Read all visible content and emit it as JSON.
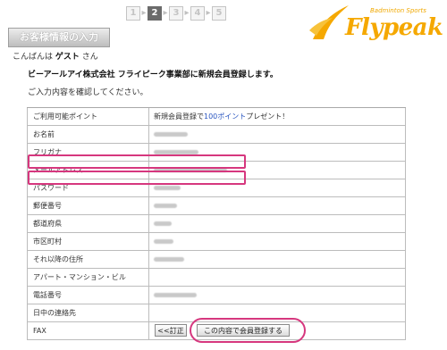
{
  "steps": [
    "1",
    "2",
    "3",
    "4",
    "5"
  ],
  "logo": {
    "subtitle": "Badminton Sports",
    "brand": "Flypeak"
  },
  "header": {
    "tab_label": "お客様情報の入力"
  },
  "greeting": {
    "prefix": "こんばんは",
    "name": "ゲスト",
    "suffix": "さん"
  },
  "heading": "ビーアールアイ株式会社 フライピーク事業部に新規会員登録します。",
  "confirm_text": "ご入力内容を確認してください。",
  "fields": [
    {
      "label": "ご利用可能ポイント",
      "value_pre": "新規会員登録で",
      "value_link": "100ポイント",
      "value_post": "プレゼント！"
    },
    {
      "label": "お名前"
    },
    {
      "label": "フリガナ"
    },
    {
      "label": "メールアドレス"
    },
    {
      "label": "パスワード"
    },
    {
      "label": "郵便番号"
    },
    {
      "label": "都道府県"
    },
    {
      "label": "市区町村"
    },
    {
      "label": "それ以降の住所"
    },
    {
      "label": "アパート・マンション・ビル"
    },
    {
      "label": "電話番号"
    },
    {
      "label": "日中の連絡先"
    },
    {
      "label": "FAX"
    }
  ],
  "buttons": {
    "back": "<<訂正",
    "submit": "この内容で会員登録する"
  },
  "colors": {
    "highlight": "#d6377e",
    "brand": "#f5a800",
    "link": "#2a56c0"
  }
}
